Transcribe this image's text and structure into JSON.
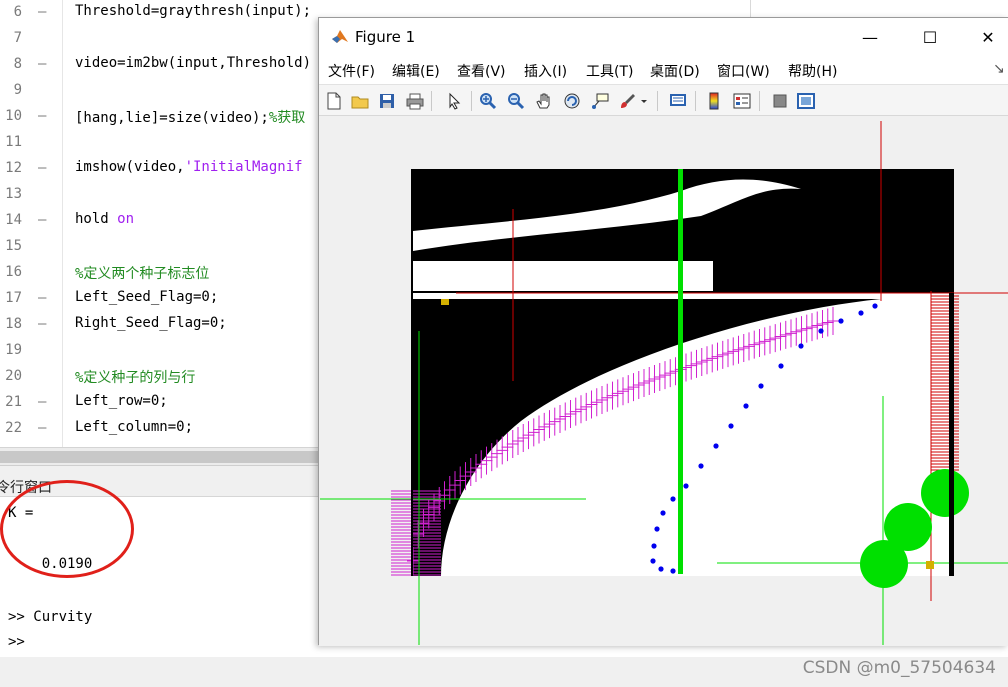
{
  "editor": {
    "lines": [
      {
        "num": "6",
        "dash": "–",
        "code": "Threshold=graythresh(input);"
      },
      {
        "num": "7",
        "dash": "",
        "code": ""
      },
      {
        "num": "8",
        "dash": "–",
        "code": "video=im2bw(input,Threshold)"
      },
      {
        "num": "9",
        "dash": "",
        "code": ""
      },
      {
        "num": "10",
        "dash": "–",
        "code": "[hang,lie]=size(video);",
        "comment": "%获取"
      },
      {
        "num": "11",
        "dash": "",
        "code": ""
      },
      {
        "num": "12",
        "dash": "–",
        "code": "imshow(video,",
        "string": "'InitialMagnif"
      },
      {
        "num": "13",
        "dash": "",
        "code": ""
      },
      {
        "num": "14",
        "dash": "–",
        "code": "hold ",
        "keyword": "on"
      },
      {
        "num": "15",
        "dash": "",
        "code": ""
      },
      {
        "num": "16",
        "dash": "",
        "comment_only": "%定义两个种子标志位"
      },
      {
        "num": "17",
        "dash": "–",
        "code": "Left_Seed_Flag=0;"
      },
      {
        "num": "18",
        "dash": "–",
        "code": "Right_Seed_Flag=0;"
      },
      {
        "num": "19",
        "dash": "",
        "code": ""
      },
      {
        "num": "20",
        "dash": "",
        "comment_only": "%定义种子的列与行"
      },
      {
        "num": "21",
        "dash": "–",
        "code": "Left_row=0;"
      },
      {
        "num": "22",
        "dash": "–",
        "code": "Left_column=0;"
      }
    ]
  },
  "command_window": {
    "title": "令行窗口",
    "lines": [
      "K =",
      "",
      "",
      "    0.0190",
      "",
      ">> Curvity",
      ">>"
    ]
  },
  "watermark": "CSDN @m0_57504634",
  "figure": {
    "title": "Figure 1",
    "window_buttons": {
      "minimize": "—",
      "maximize": "☐",
      "close": "✕"
    },
    "menu": [
      "文件(F)",
      "编辑(E)",
      "查看(V)",
      "插入(I)",
      "工具(T)",
      "桌面(D)",
      "窗口(W)",
      "帮助(H)"
    ],
    "menu_overflow": "↘",
    "toolbar": [
      "new-figure",
      "open-file",
      "save",
      "print",
      "pointer",
      "zoom-in",
      "zoom-out",
      "pan",
      "rotate-3d",
      "data-cursor",
      "brush",
      "brush-dropdown",
      "link-plot",
      "insert-colorbar",
      "insert-legend",
      "hide-plot-tools",
      "show-plot-tools"
    ]
  },
  "colors": {
    "accent_red": "#e0201a",
    "plot_green": "#00e000",
    "plot_blue": "#0000ee",
    "plot_magenta": "#d020d0",
    "plot_red": "#d00000",
    "comment_green": "#228b22",
    "string_purple": "#a020f0"
  }
}
